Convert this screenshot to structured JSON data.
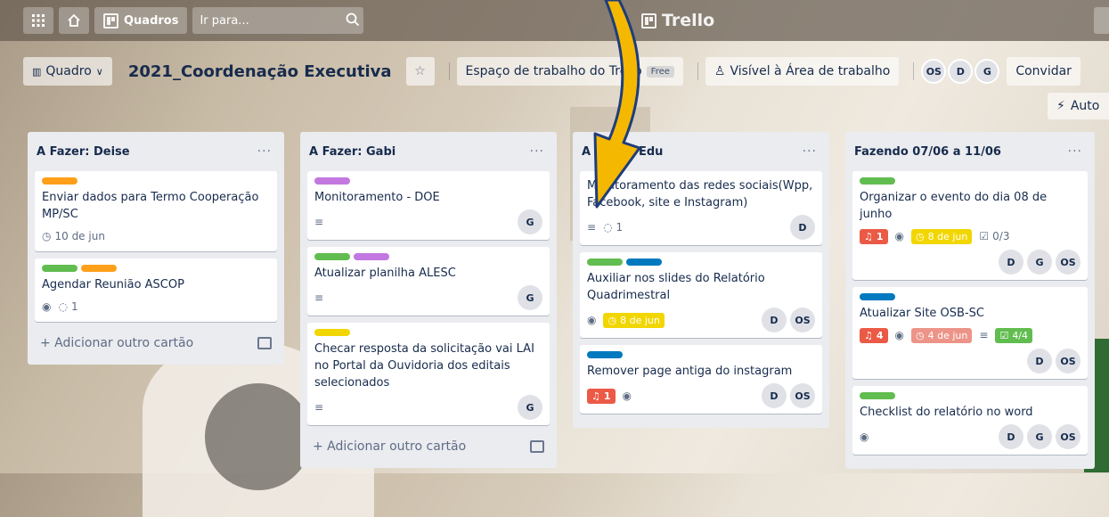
{
  "colors": {
    "green": "#61bd4f",
    "orange": "#ff9f1a",
    "purple": "#c377e0",
    "yellow": "#f2d600",
    "blue": "#0079bf",
    "red": "#eb5a46"
  },
  "topbar": {
    "apps_icon": "grid-icon",
    "home_icon": "house-icon",
    "boards_label": "Quadros",
    "search_placeholder": "Ir para...",
    "logo_text": "Trello"
  },
  "board": {
    "view_label": "Quadro",
    "title": "2021_Coordenação Executiva",
    "workspace_label": "Espaço de trabalho do Trello",
    "free_badge": "Free",
    "visibility_label": "Visível à Área de trabalho",
    "members": [
      "OS",
      "D",
      "G"
    ],
    "invite_label": "Convidar",
    "automation_label": "Auto"
  },
  "lists": [
    {
      "title": "A Fazer: Deise",
      "menu": "···",
      "cards": [
        {
          "labels": [
            "orange"
          ],
          "title": "Enviar dados para Termo Cooperação MP/SC",
          "due": "10 de jun",
          "members": []
        },
        {
          "labels": [
            "green",
            "orange"
          ],
          "title": "Agendar Reunião ASCOP",
          "watch": true,
          "comments": "1",
          "members": []
        }
      ],
      "add_label": "+ Adicionar outro cartão"
    },
    {
      "title": "A Fazer: Gabi",
      "menu": "···",
      "cards": [
        {
          "labels": [
            "purple"
          ],
          "title": "Monitoramento - DOE",
          "description": true,
          "members": [
            "G"
          ]
        },
        {
          "labels": [
            "green",
            "purple"
          ],
          "title": "Atualizar planilha ALESC",
          "description": true,
          "members": [
            "G"
          ]
        },
        {
          "labels": [
            "yellow"
          ],
          "title": "Checar resposta da solicitação vai LAI no Portal da Ouvidoria dos editais selecionados",
          "description": true,
          "members": [
            "G"
          ]
        }
      ],
      "add_label": "+ Adicionar outro cartão"
    },
    {
      "title": "A Fazer: Edu",
      "menu": "···",
      "cards": [
        {
          "labels": [],
          "title": "Monitoramento das redes sociais(Wpp, Facebook, site e Instagram)",
          "description": true,
          "comments": "1",
          "members": [
            "D"
          ]
        },
        {
          "labels": [
            "green",
            "blue"
          ],
          "title": "Auxiliar nos slides do Relatório Quadrimestral",
          "watch": true,
          "due": "8 de jun",
          "due_style": "yellow",
          "members": [
            "D",
            "OS"
          ]
        },
        {
          "labels": [
            "blue"
          ],
          "title": "Remover page antiga do instagram",
          "notifications": "1",
          "watch": true,
          "members": [
            "D",
            "OS"
          ]
        }
      ]
    },
    {
      "title": "Fazendo 07/06 a 11/06",
      "menu": "···",
      "cards": [
        {
          "labels": [
            "green"
          ],
          "title": "Organizar o evento do dia 08 de junho",
          "notifications": "1",
          "watch": true,
          "due": "8 de jun",
          "due_style": "yellow",
          "checklist": "0/3",
          "members": [
            "D",
            "G",
            "OS"
          ]
        },
        {
          "labels": [
            "blue"
          ],
          "title": "Atualizar Site OSB-SC",
          "notifications": "4",
          "watch": true,
          "due": "4 de jun",
          "due_style": "red",
          "description": true,
          "checklist": "4/4",
          "checklist_style": "green",
          "members": [
            "D",
            "OS"
          ]
        },
        {
          "labels": [
            "green"
          ],
          "title": "Checklist do relatório no word",
          "watch": true,
          "members": [
            "D",
            "G",
            "OS"
          ]
        }
      ]
    }
  ]
}
